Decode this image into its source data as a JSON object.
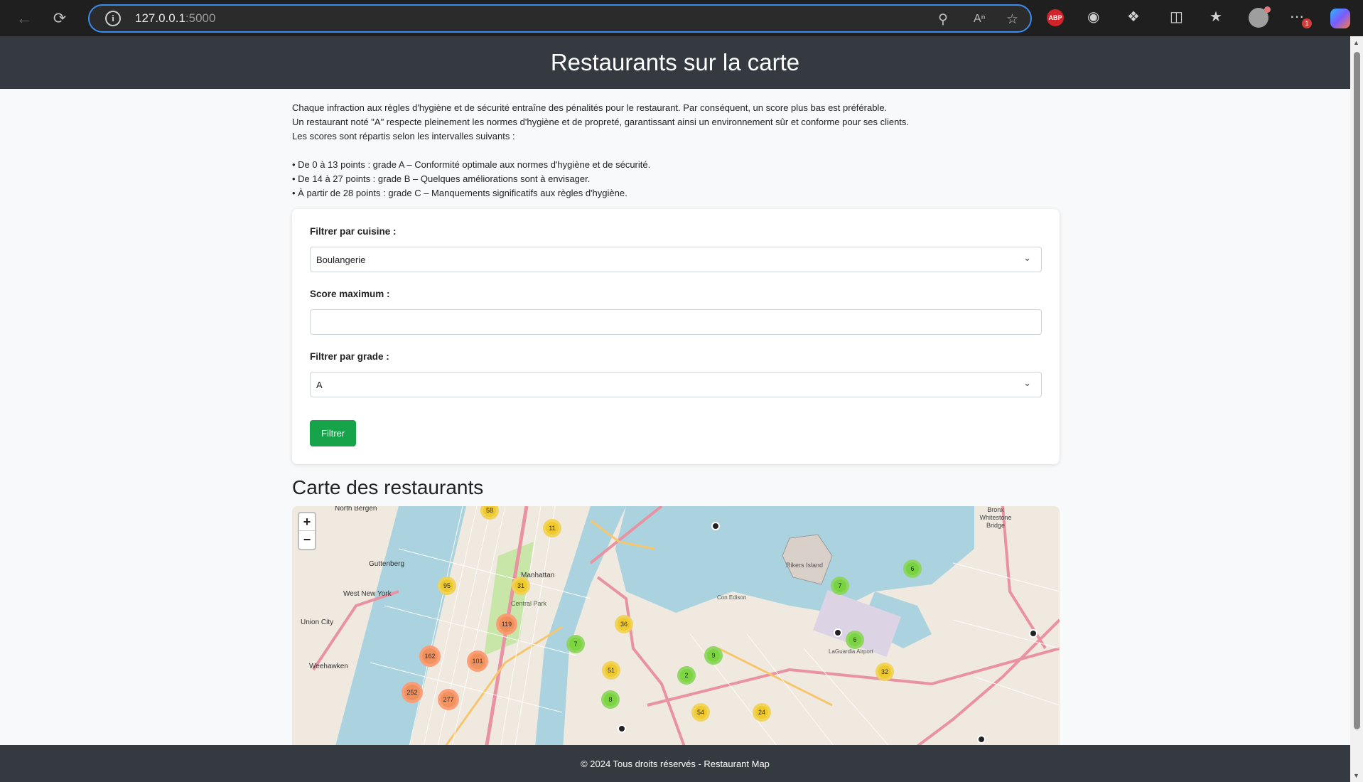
{
  "browser": {
    "url_host": "127.0.0.1",
    "url_port": ":5000",
    "abp_label": "ABP",
    "notification_count": "1"
  },
  "header": {
    "title": "Restaurants sur la carte"
  },
  "intro": {
    "lines": [
      "Chaque infraction aux règles d'hygiène et de sécurité entraîne des pénalités pour le restaurant. Par conséquent, un score plus bas est préférable.",
      "Un restaurant noté \"A\" respecte pleinement les normes d'hygiène et de propreté, garantissant ainsi un environnement sûr et conforme pour ses clients.",
      "Les scores sont répartis selon les intervalles suivants :"
    ],
    "bullets": [
      "• De 0 à 13 points : grade A – Conformité optimale aux normes d'hygiène et de sécurité.",
      "• De 14 à 27 points : grade B – Quelques améliorations sont à envisager.",
      "• À partir de 28 points : grade C – Manquements significatifs aux règles d'hygiène."
    ]
  },
  "filters": {
    "cuisine_label": "Filtrer par cuisine :",
    "cuisine_value": "Boulangerie",
    "score_label": "Score maximum :",
    "score_value": "",
    "grade_label": "Filtrer par grade :",
    "grade_value": "A",
    "submit_label": "Filtrer"
  },
  "map": {
    "title": "Carte des restaurants",
    "zoom_in": "+",
    "zoom_out": "−",
    "place_labels": [
      "North Bergen",
      "Guttenberg",
      "West New York",
      "Union City",
      "Weehawken",
      "Manhattan",
      "Central Park",
      "Rikers Island",
      "Bronx Whitestone Bridge",
      "Con Edison",
      "LaGuardia Airport"
    ],
    "clusters": [
      {
        "count": 58,
        "color": "#f1d357"
      },
      {
        "count": 11,
        "color": "#f1d357"
      },
      {
        "count": 95,
        "color": "#f1d357"
      },
      {
        "count": 31,
        "color": "#f1d357"
      },
      {
        "count": 119,
        "color": "#fd9c73"
      },
      {
        "count": 162,
        "color": "#fd9c73"
      },
      {
        "count": 101,
        "color": "#fd9c73"
      },
      {
        "count": 252,
        "color": "#fd9c73"
      },
      {
        "count": 277,
        "color": "#fd9c73"
      },
      {
        "count": 36,
        "color": "#f1d357"
      },
      {
        "count": 7,
        "color": "#8ed660"
      },
      {
        "count": 51,
        "color": "#f1d357"
      },
      {
        "count": 8,
        "color": "#8ed660"
      },
      {
        "count": 9,
        "color": "#8ed660"
      },
      {
        "count": 2,
        "color": "#8ed660"
      },
      {
        "count": 7,
        "color": "#8ed660"
      },
      {
        "count": 6,
        "color": "#8ed660"
      },
      {
        "count": 6,
        "color": "#8ed660"
      },
      {
        "count": 32,
        "color": "#f1d357"
      },
      {
        "count": 54,
        "color": "#f1d357"
      },
      {
        "count": 24,
        "color": "#f1d357"
      }
    ]
  },
  "footer": {
    "text": "© 2024 Tous droits réservés - Restaurant Map"
  }
}
